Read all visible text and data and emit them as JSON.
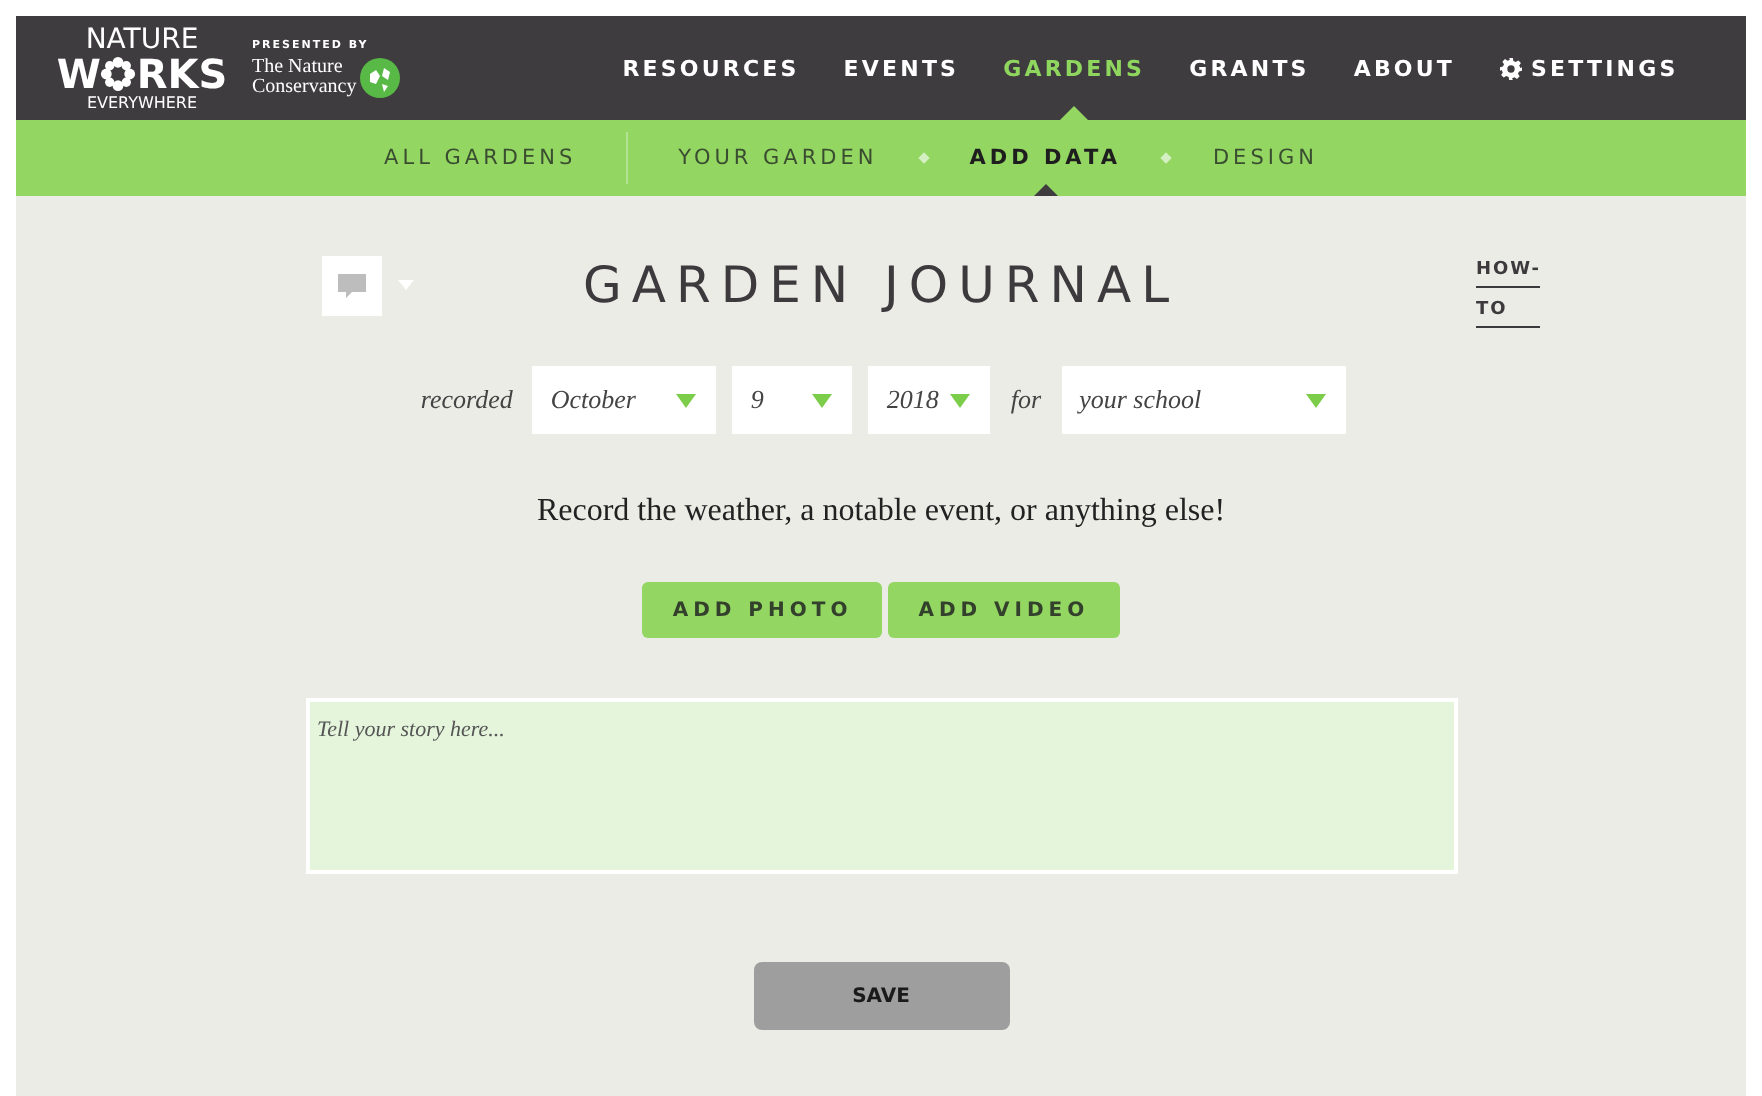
{
  "logo": {
    "line_1": "NATURE",
    "word_start": "W",
    "word_end": "RKS",
    "line_3": "EVERYWHERE"
  },
  "partner": {
    "presented_by": "PRESENTED BY",
    "name_lines": [
      "The Nature",
      "Conservancy"
    ]
  },
  "nav": [
    {
      "label": "RESOURCES",
      "selected": false,
      "kind": "link"
    },
    {
      "label": "EVENTS",
      "selected": false,
      "kind": "link"
    },
    {
      "label": "GARDENS",
      "selected": true,
      "kind": "link"
    },
    {
      "label": "GRANTS",
      "selected": false,
      "kind": "link"
    },
    {
      "label": "ABOUT",
      "selected": false,
      "kind": "link"
    },
    {
      "label": "SETTINGS",
      "selected": false,
      "kind": "settings"
    }
  ],
  "subnav": [
    {
      "label": "ALL GARDENS",
      "selected": false
    },
    {
      "label": "YOUR GARDEN",
      "selected": false
    },
    {
      "label": "ADD DATA",
      "selected": true
    },
    {
      "label": "DESIGN",
      "selected": false
    }
  ],
  "title": "GARDEN JOURNAL",
  "howto": [
    "HOW-",
    "TO"
  ],
  "recorded_label": "recorded",
  "for_label": "for",
  "selects": [
    {
      "value": "October",
      "kind": "month"
    },
    {
      "value": "9",
      "kind": "day"
    },
    {
      "value": "2018",
      "kind": "year"
    },
    {
      "value": "your school",
      "kind": "school"
    }
  ],
  "prompt": "Record the weather, a notable event, or anything else!",
  "media_buttons": [
    "ADD PHOTO",
    "ADD VIDEO"
  ],
  "story": {
    "placeholder": "Tell your story here..."
  },
  "save": "SAVE"
}
